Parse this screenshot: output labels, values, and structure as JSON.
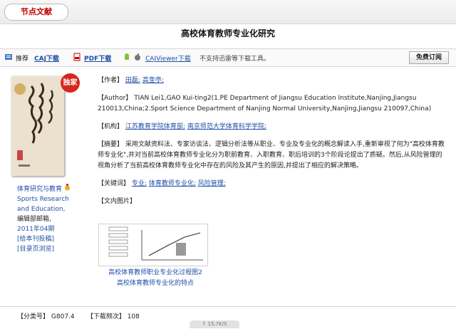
{
  "header": {
    "tag": "节点文献"
  },
  "page_title": "高校体育教师专业化研究",
  "toolbar": {
    "recommend_label": "推荐",
    "caj_download": "CAJ下载",
    "pdf_download": "PDF下载",
    "cajviewer_download": "CAJViewer下载",
    "xunlei_note": "不支持迅雷等下载工具。",
    "free_subscribe": "免费订阅"
  },
  "cover": {
    "badge": "独家"
  },
  "journal": {
    "name_cn": "体育研究与教育",
    "name_en_1": "Sports Research",
    "name_en_2": "and Education,",
    "editor": "编辑部邮箱,",
    "issue": "2011年04期",
    "contribute": "[给本刊投稿]",
    "toc": "[目录页浏览]"
  },
  "article": {
    "authors_label": "【作者】",
    "authors": [
      "田磊;",
      "高奎亭;"
    ],
    "author_en_label": "【Author】",
    "author_en": "TIAN Lei1,GAO Kui-ting2(1.PE Department of Jiangsu Education Institute,Nanjing,Jiangsu 210013,China;2.Sport Science Department of Nanjing Normal University,Nanjing,Jiangsu 210097,China)",
    "org_label": "【机构】",
    "orgs": [
      "江苏教育学院体育部;",
      "南京师范大学体育科学学院;"
    ],
    "abstract_label": "【摘要】",
    "abstract": "采用文献资料法、专家访谈法、逻辑分析法等从职业、专业及专业化的概念解读入手,重新审视了何为\"高校体育教师专业化\",并对当前高校体育教师专业化分为职前教育、入职教育、职后培训的3个阶段论提出了质疑。然后,从风险管理的视角分析了当前高校体育教师专业化中存在的风险及其产生的原因,并提出了相应的解决策略。",
    "keywords_label": "【关键词】",
    "keywords": [
      "专业;",
      "体育教师专业化;",
      "风险管理;"
    ],
    "figures_label": "【文内图片】",
    "figure_caption_1": "高校体育教师职业专业化过程图2",
    "figure_caption_2": "高校体育教师专业化的特点"
  },
  "footer": {
    "class_label": "【分类号】",
    "class_value": "G807.4",
    "download_label": "【下载频次】",
    "download_value": "108",
    "speed": "↑ 15.7K/S"
  },
  "colors": {
    "link": "#1e4fa8",
    "tag_red": "#c00000",
    "badge_red": "#d8261c"
  }
}
